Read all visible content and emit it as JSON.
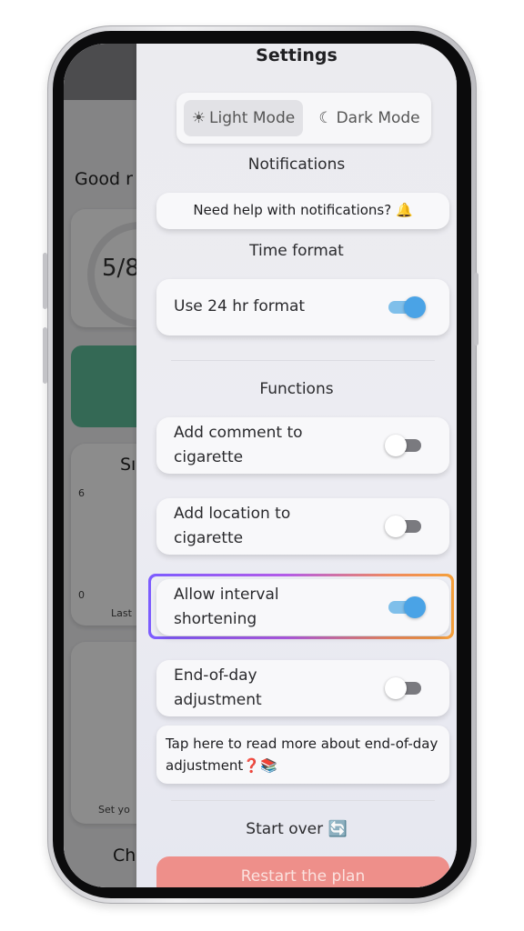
{
  "background": {
    "greeting": "Good r",
    "progress": "5/8",
    "chart_top_tick": "6",
    "chart_bottom_tick": "0",
    "heading_fragment": "Sı",
    "chart_caption": "Last",
    "card_caption": "Set yo",
    "bottom_heading": "Ch"
  },
  "settings": {
    "title": "Settings",
    "theme": {
      "light_label": "Light Mode",
      "dark_label": "Dark Mode",
      "light_icon": "☀",
      "dark_icon": "☾",
      "selected": "light"
    },
    "notifications": {
      "heading": "Notifications",
      "help_label": "Need help with notifications? 🔔"
    },
    "time_format": {
      "heading": "Time format",
      "option_label": "Use 24 hr format",
      "enabled": true
    },
    "functions": {
      "heading": "Functions",
      "items": [
        {
          "label_line1": "Add comment to",
          "label_line2": "cigarette",
          "enabled": false
        },
        {
          "label_line1": "Add location to",
          "label_line2": "cigarette",
          "enabled": false
        },
        {
          "label_line1": "Allow interval",
          "label_line2": "shortening",
          "enabled": true
        },
        {
          "label_line1": "End-of-day",
          "label_line2": "adjustment",
          "enabled": false
        }
      ],
      "info_text": "Tap here to read more about end-of-day adjustment❓📚"
    },
    "start_over": {
      "heading": "Start over 🔄",
      "button_label": "Restart the plan"
    }
  },
  "colors": {
    "toggle_on": "#4aa3e6",
    "restart_button": "#ee8f8a",
    "highlight_gradient_start": "#7c5cff",
    "highlight_gradient_end": "#f5a03a",
    "background_green": "#5fbf9c"
  }
}
